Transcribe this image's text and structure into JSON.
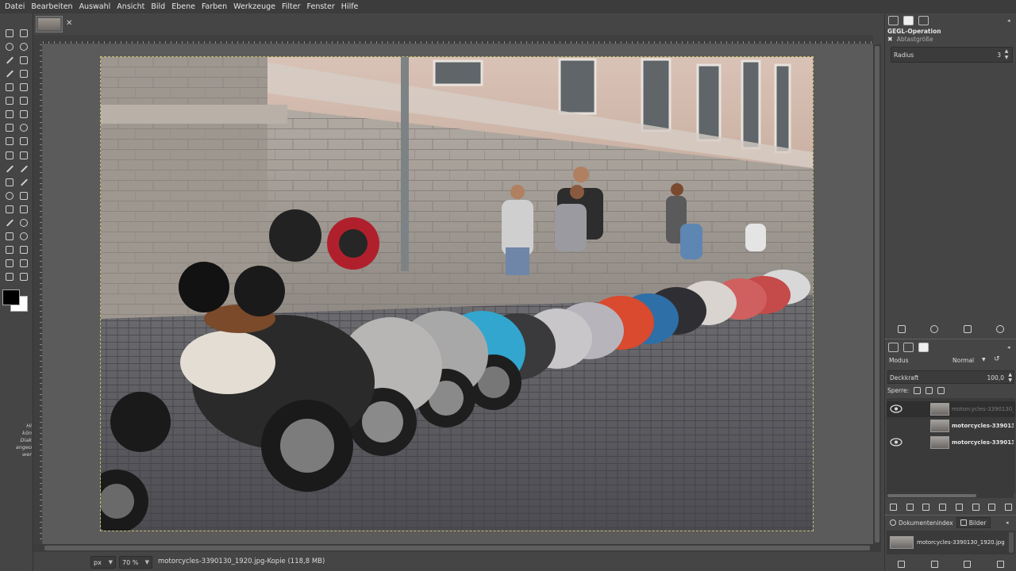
{
  "menubar": {
    "items": [
      "Datei",
      "Bearbeiten",
      "Auswahl",
      "Ansicht",
      "Bild",
      "Ebene",
      "Farben",
      "Werkzeuge",
      "Filter",
      "Fenster",
      "Hilfe"
    ]
  },
  "image_tab": {
    "close": "✕"
  },
  "toolbox": {
    "hint_text": "Hi\nkön\nDiak\nangeo\nwer",
    "foreground_color": "#000000",
    "background_color": "#ffffff"
  },
  "statusbar": {
    "unit": "px",
    "zoom": "70 %",
    "info": "motorcycles-3390130_1920.jpg-Kopie (118,8 MB)"
  },
  "gegl_panel": {
    "title": "GEGL-Operation",
    "subtitle": "Abtastgröße",
    "radius_label": "Radius",
    "radius_value": "3"
  },
  "layers_panel": {
    "mode_label": "Modus",
    "mode_value": "Normal",
    "opacity_label": "Deckkraft",
    "opacity_value": "100,0",
    "lock_label": "Sperre:",
    "layers": [
      {
        "name": "motorcycles-3390130_1920",
        "visible": true,
        "selected": true
      },
      {
        "name": "motorcycles-3390130_",
        "visible": false,
        "selected": false
      },
      {
        "name": "motorcycles-3390130_",
        "visible": true,
        "selected": false
      }
    ]
  },
  "documents_panel": {
    "tab_index": "Dokumentenindex",
    "tab_images": "Bilder",
    "item": "motorcycles-3390130_1920.jpg"
  }
}
